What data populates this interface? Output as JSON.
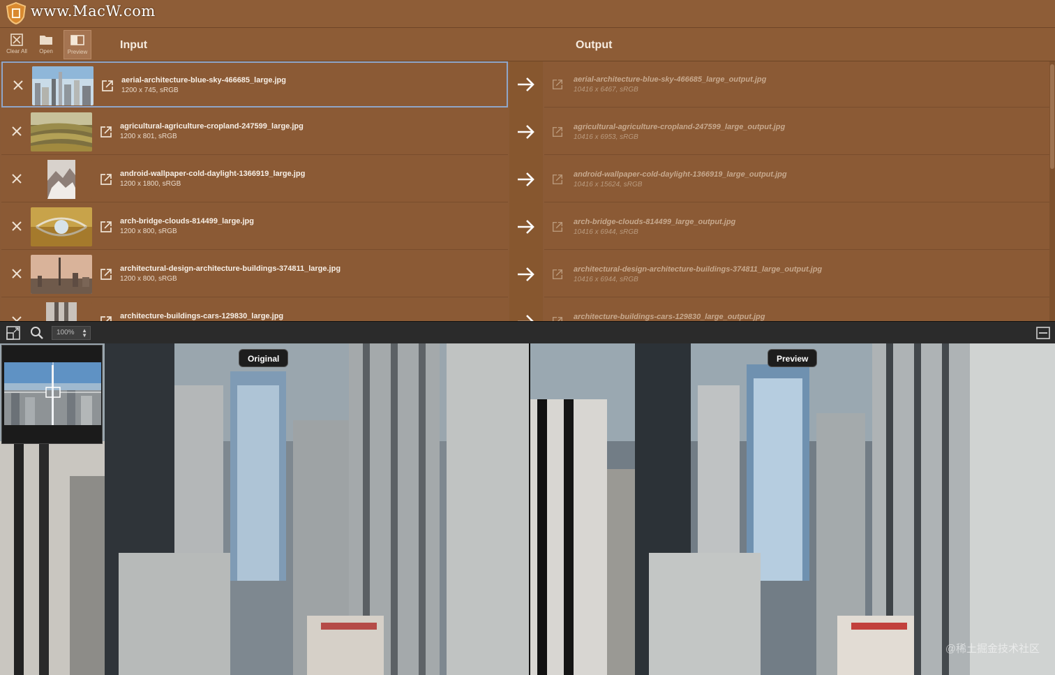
{
  "app": {
    "watermark": "www.MacW.com"
  },
  "toolbar": {
    "clear_all_label": "Clear All",
    "open_label": "Open",
    "preview_label": "Preview",
    "input_header": "Input",
    "output_header": "Output"
  },
  "files": [
    {
      "name": "aerial-architecture-blue-sky-466685_large.jpg",
      "meta": "1200 x 745, sRGB",
      "output_name": "aerial-architecture-blue-sky-466685_large_output.jpg",
      "output_meta": "10416 x 6467, sRGB",
      "selected": true
    },
    {
      "name": "agricultural-agriculture-cropland-247599_large.jpg",
      "meta": "1200 x 801, sRGB",
      "output_name": "agricultural-agriculture-cropland-247599_large_output.jpg",
      "output_meta": "10416 x 6953, sRGB"
    },
    {
      "name": "android-wallpaper-cold-daylight-1366919_large.jpg",
      "meta": "1200 x 1800, sRGB",
      "output_name": "android-wallpaper-cold-daylight-1366919_large_output.jpg",
      "output_meta": "10416 x 15624, sRGB"
    },
    {
      "name": "arch-bridge-clouds-814499_large.jpg",
      "meta": "1200 x 800, sRGB",
      "output_name": "arch-bridge-clouds-814499_large_output.jpg",
      "output_meta": "10416 x 6944, sRGB"
    },
    {
      "name": "architectural-design-architecture-buildings-374811_large.jpg",
      "meta": "1200 x 800, sRGB",
      "output_name": "architectural-design-architecture-buildings-374811_large_output.jpg",
      "output_meta": "10416 x 6944, sRGB"
    },
    {
      "name": "architecture-buildings-cars-129830_large.jpg",
      "meta": "",
      "output_name": "architecture-buildings-cars-129830_large_output.jpg",
      "output_meta": ""
    }
  ],
  "preview": {
    "zoom": "100%",
    "original_label": "Original",
    "preview_label": "Preview",
    "credit": "@稀土掘金技术社区"
  },
  "colors": {
    "background": "#8a5a36",
    "selection_border": "#8fa6c8",
    "preview_bar": "#2b2b2b"
  }
}
